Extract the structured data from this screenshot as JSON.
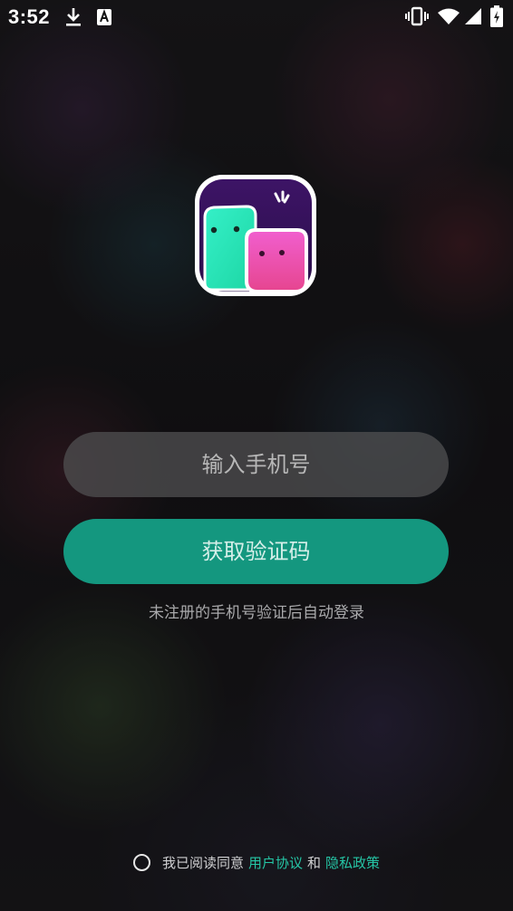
{
  "status_bar": {
    "time": "3:52",
    "icons": [
      "download-icon",
      "a-icon",
      "vibrate-icon",
      "wifi-icon",
      "signal-icon",
      "battery-icon"
    ]
  },
  "app": {
    "logo_icon": "app-logo-icon"
  },
  "login": {
    "phone_placeholder": "输入手机号",
    "phone_value": "",
    "get_code_label": "获取验证码",
    "hint": "未注册的手机号验证后自动登录"
  },
  "agreement": {
    "checked": false,
    "prefix": "我已阅读同意",
    "user_agreement": "用户协议",
    "and": "和",
    "privacy_policy": "隐私政策"
  },
  "colors": {
    "accent": "#14977f",
    "link": "#25c6a6",
    "input_bg": "#505052"
  }
}
